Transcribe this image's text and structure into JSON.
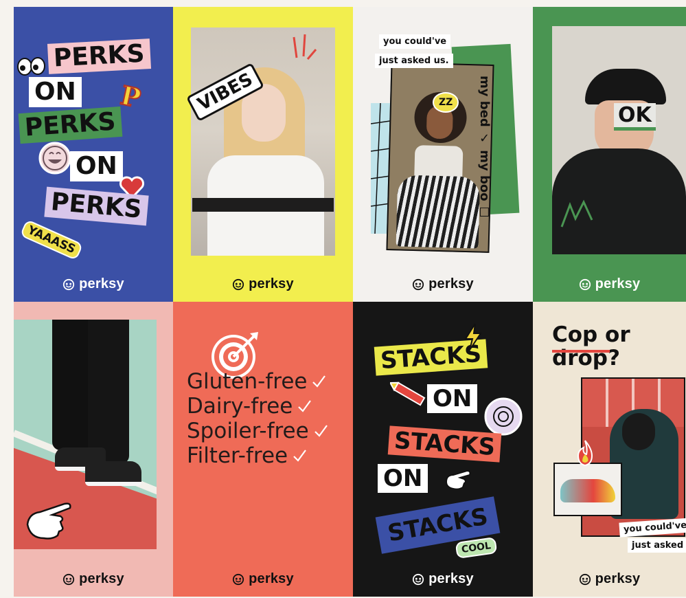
{
  "brand": {
    "logo_text": "perksy"
  },
  "posters": {
    "perks": {
      "bg": "#3b50a6",
      "tags": [
        "PERKS",
        "ON",
        "PERKS",
        "ON",
        "PERKS"
      ],
      "sticker_p": "P",
      "sticker_yaaass": "YAAASS"
    },
    "vibes": {
      "bg": "#f2ee4e",
      "sticker": "VIBES"
    },
    "asked": {
      "bg": "#f3f1ee",
      "caption_1": "you could've",
      "caption_2": "just asked us.",
      "side_text": "my bed ✓ my boo ☐",
      "sticker": "ZZ"
    },
    "ok": {
      "bg": "#4a9552",
      "sticker": "OK"
    },
    "shoes": {
      "bg": "#f1b9b3"
    },
    "free": {
      "bg": "#ef6b57",
      "items": [
        "Gluten-free",
        "Dairy-free",
        "Spoiler-free",
        "Filter-free"
      ]
    },
    "stacks": {
      "bg": "#161616",
      "tags": [
        "STACKS",
        "ON",
        "STACKS",
        "ON",
        "STACKS"
      ],
      "sticker": "COOL"
    },
    "cop": {
      "bg": "#efe6d5",
      "headline_1": "Cop or",
      "headline_2": "drop?",
      "caption_1": "you could've",
      "caption_2": "just asked us"
    }
  }
}
